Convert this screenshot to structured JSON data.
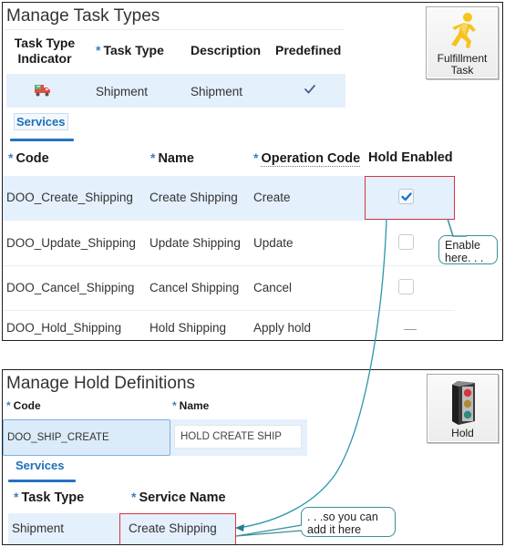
{
  "task_types": {
    "title": "Manage Task Types",
    "columns": {
      "indicator": "Task Type Indicator",
      "task_type": "Task Type",
      "description": "Description",
      "predefined": "Predefined"
    },
    "row": {
      "indicator_icon": "shipment-truck-icon",
      "task_type": "Shipment",
      "description": "Shipment",
      "predefined": true
    },
    "fulfillment_button": {
      "line1": "Fulfillment",
      "line2": "Task",
      "icon": "running-person-icon"
    },
    "services_tab": "Services",
    "services_columns": {
      "code": "Code",
      "name": "Name",
      "operation_code": "Operation Code",
      "hold_enabled": "Hold Enabled"
    },
    "services_rows": [
      {
        "code": "DOO_Create_Shipping",
        "name": "Create Shipping",
        "operation_code": "Create",
        "hold_enabled": "checked"
      },
      {
        "code": "DOO_Update_Shipping",
        "name": "Update Shipping",
        "operation_code": "Update",
        "hold_enabled": "unchecked"
      },
      {
        "code": "DOO_Cancel_Shipping",
        "name": "Cancel Shipping",
        "operation_code": "Cancel",
        "hold_enabled": "unchecked"
      },
      {
        "code": "DOO_Hold_Shipping",
        "name": "Hold Shipping",
        "operation_code": "Apply hold",
        "hold_enabled": "none"
      }
    ],
    "callout": "Enable here. . ."
  },
  "hold_definitions": {
    "title": "Manage Hold Definitions",
    "code_label": "Code",
    "name_label": "Name",
    "code_value": "DOO_SHIP_CREATE",
    "name_value": "HOLD CREATE SHIP",
    "hold_button": {
      "label": "Hold",
      "icon": "traffic-light-icon"
    },
    "services_tab": "Services",
    "services_columns": {
      "task_type": "Task Type",
      "service_name": "Service Name"
    },
    "services_row": {
      "task_type": "Shipment",
      "service_name": "Create Shipping"
    },
    "callout": ". . .so you can add it here"
  },
  "colors": {
    "accent": "#2672c2",
    "selected_row": "#e4f0fc",
    "highlight_border": "#d9333f",
    "callout_border": "#3a8e9a"
  }
}
